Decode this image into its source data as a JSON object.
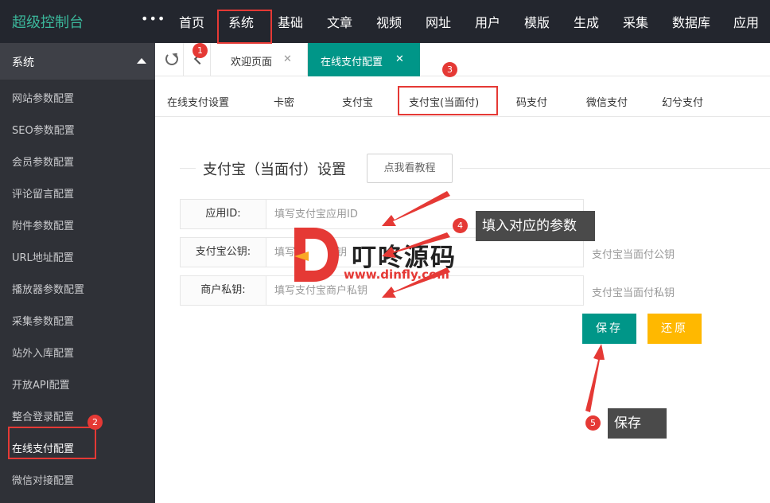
{
  "header": {
    "logo": "超级控制台",
    "more": "•••",
    "nav": [
      "首页",
      "系统",
      "基础",
      "文章",
      "视频",
      "网址",
      "用户",
      "模版",
      "生成",
      "采集",
      "数据库",
      "应用"
    ]
  },
  "sidebar": {
    "section": "系统",
    "items": [
      "网站参数配置",
      "SEO参数配置",
      "会员参数配置",
      "评论留言配置",
      "附件参数配置",
      "URL地址配置",
      "播放器参数配置",
      "采集参数配置",
      "站外入库配置",
      "开放API配置",
      "整合登录配置",
      "在线支付配置",
      "微信对接配置"
    ]
  },
  "tabs": {
    "welcome": "欢迎页面",
    "pay": "在线支付配置",
    "close": "✕"
  },
  "subtabs": [
    "在线支付设置",
    "卡密",
    "支付宝",
    "支付宝(当面付)",
    "码支付",
    "微信支付",
    "幻兮支付"
  ],
  "form": {
    "title": "支付宝（当面付）设置",
    "tutorial": "点我看教程",
    "fields": [
      {
        "label": "应用ID:",
        "placeholder": "填写支付宝应用ID",
        "aux": ""
      },
      {
        "label": "支付宝公钥:",
        "placeholder": "填写支付宝公钥",
        "aux": "支付宝当面付公钥"
      },
      {
        "label": "商户私钥:",
        "placeholder": "填写支付宝商户私钥",
        "aux": "支付宝当面付私钥"
      }
    ],
    "save": "保存",
    "reset": "还原"
  },
  "annotations": {
    "markers": [
      "1",
      "2",
      "3",
      "4",
      "5"
    ],
    "callout_params": "填入对应的参数",
    "callout_save": "保存"
  },
  "watermark": {
    "letter": "D",
    "text": "叮咚源码",
    "url": "www.dinfly.com"
  },
  "colors": {
    "topbar": "#23262e",
    "sidebar": "#2f3137",
    "accent": "#009688",
    "warning": "#ffb800",
    "annotation": "#e53935"
  }
}
